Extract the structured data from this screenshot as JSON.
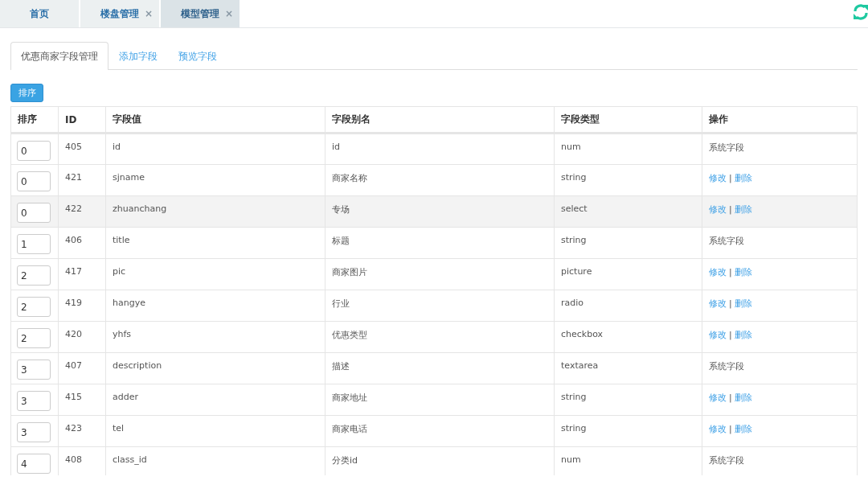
{
  "top_tabs": [
    {
      "label": "首页",
      "selected": false
    },
    {
      "label": "楼盘管理",
      "selected": false,
      "close": "×"
    },
    {
      "label": "模型管理",
      "selected": true,
      "close": "×"
    }
  ],
  "sub_tabs": [
    {
      "label": "优惠商家字段管理",
      "selected": true
    },
    {
      "label": "添加字段",
      "selected": false
    },
    {
      "label": "预览字段",
      "selected": false
    }
  ],
  "sort_button": "排序",
  "table": {
    "columns": [
      "排序",
      "ID",
      "字段值",
      "字段别名",
      "字段类型",
      "操作"
    ],
    "rows": [
      {
        "order": "0",
        "id": "405",
        "value": "id",
        "alias": "id",
        "type": "num",
        "highlighted": false,
        "action": {
          "kind": "system",
          "text": "系统字段"
        }
      },
      {
        "order": "0",
        "id": "421",
        "value": "sjname",
        "alias": "商家名称",
        "type": "string",
        "highlighted": false,
        "action": {
          "kind": "links",
          "edit": "修改",
          "sep": "|",
          "delete": "删除"
        }
      },
      {
        "order": "0",
        "id": "422",
        "value": "zhuanchang",
        "alias": "专场",
        "type": "select",
        "highlighted": true,
        "action": {
          "kind": "links",
          "edit": "修改",
          "sep": "|",
          "delete": "删除"
        }
      },
      {
        "order": "1",
        "id": "406",
        "value": "title",
        "alias": "标题",
        "type": "string",
        "highlighted": false,
        "action": {
          "kind": "system",
          "text": "系统字段"
        }
      },
      {
        "order": "2",
        "id": "417",
        "value": "pic",
        "alias": "商家图片",
        "type": "picture",
        "highlighted": false,
        "action": {
          "kind": "links",
          "edit": "修改",
          "sep": "|",
          "delete": "删除"
        }
      },
      {
        "order": "2",
        "id": "419",
        "value": "hangye",
        "alias": "行业",
        "type": "radio",
        "highlighted": false,
        "action": {
          "kind": "links",
          "edit": "修改",
          "sep": "|",
          "delete": "删除"
        }
      },
      {
        "order": "2",
        "id": "420",
        "value": "yhfs",
        "alias": "优惠类型",
        "type": "checkbox",
        "highlighted": false,
        "action": {
          "kind": "links",
          "edit": "修改",
          "sep": "|",
          "delete": "删除"
        }
      },
      {
        "order": "3",
        "id": "407",
        "value": "description",
        "alias": "描述",
        "type": "textarea",
        "highlighted": false,
        "action": {
          "kind": "system",
          "text": "系统字段"
        }
      },
      {
        "order": "3",
        "id": "415",
        "value": "adder",
        "alias": "商家地址",
        "type": "string",
        "highlighted": false,
        "action": {
          "kind": "links",
          "edit": "修改",
          "sep": "|",
          "delete": "删除"
        }
      },
      {
        "order": "3",
        "id": "423",
        "value": "tel",
        "alias": "商家电话",
        "type": "string",
        "highlighted": false,
        "action": {
          "kind": "links",
          "edit": "修改",
          "sep": "|",
          "delete": "删除"
        }
      },
      {
        "order": "4",
        "id": "408",
        "value": "class_id",
        "alias": "分类id",
        "type": "num",
        "highlighted": false,
        "action": {
          "kind": "system",
          "text": "系统字段"
        }
      }
    ]
  }
}
